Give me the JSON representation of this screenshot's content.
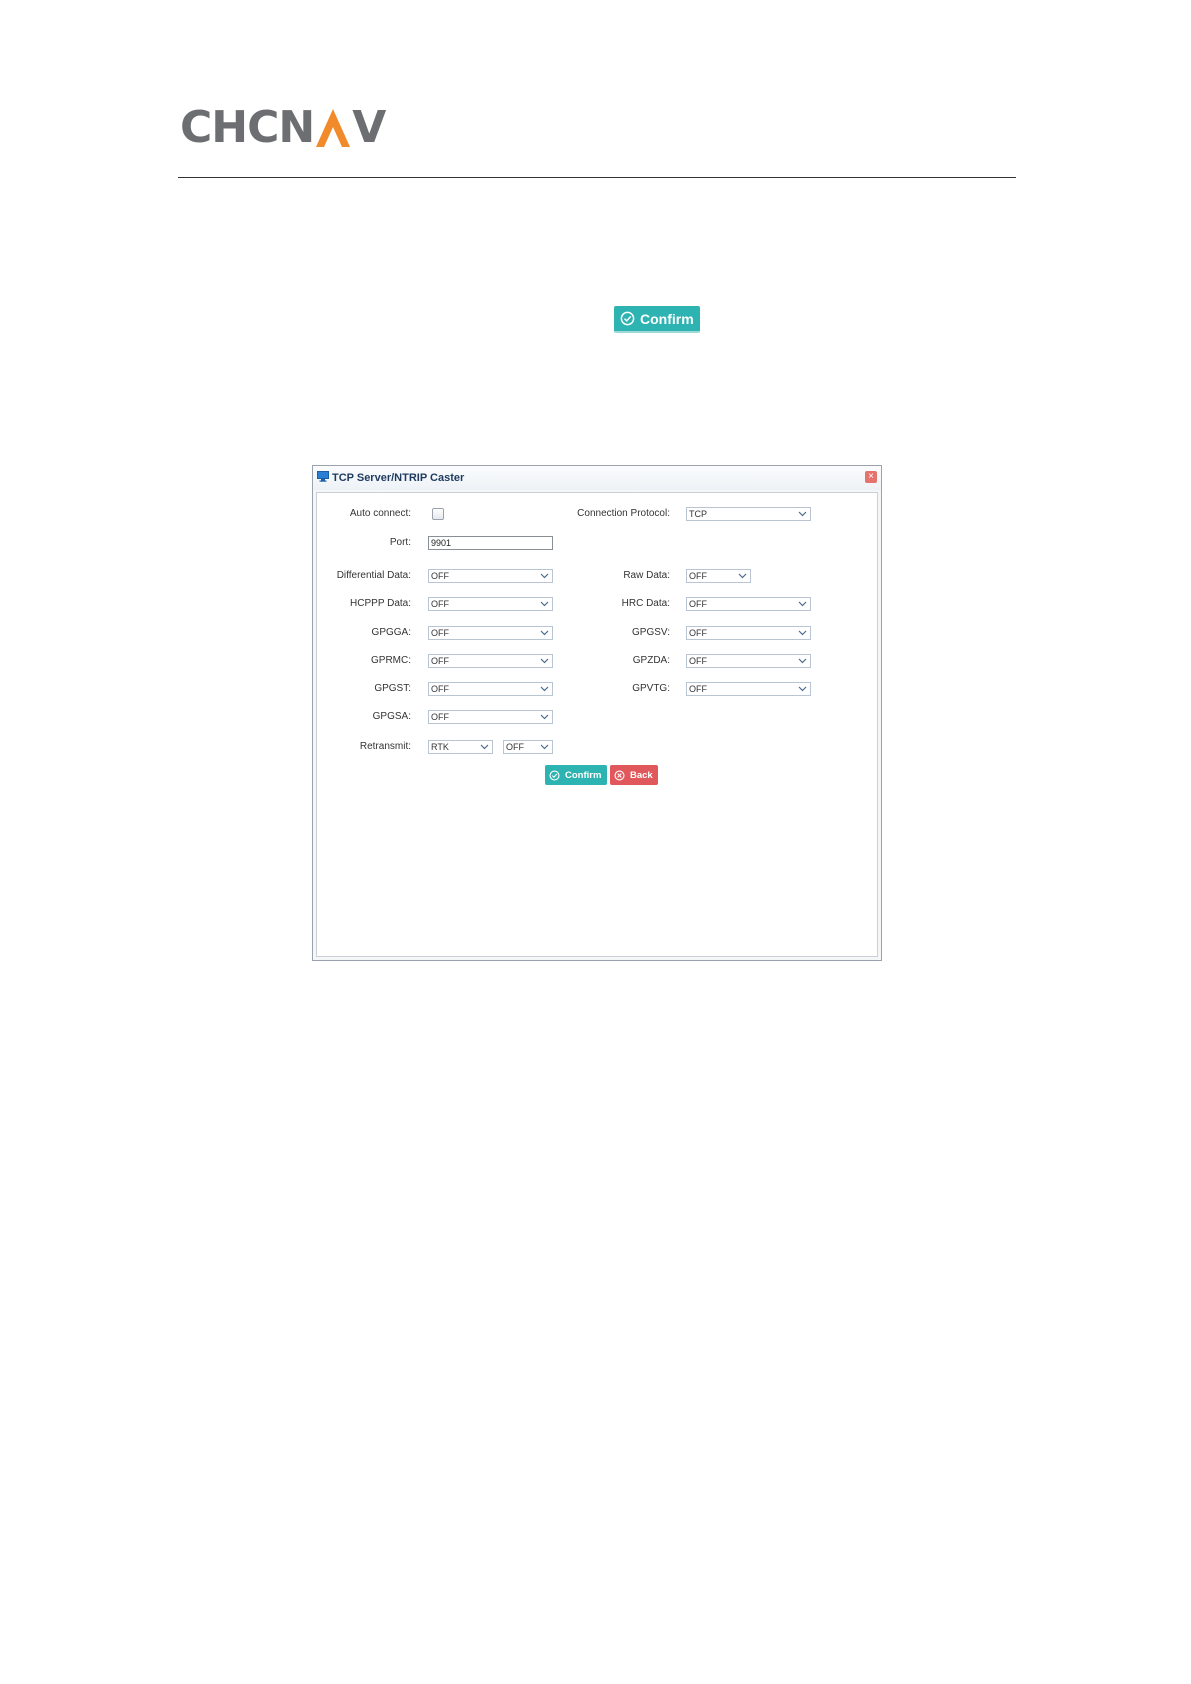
{
  "header": {
    "logo_left": "CHCN",
    "logo_right": "V"
  },
  "doc_button": {
    "label": "Confirm"
  },
  "dialog": {
    "title": "TCP Server/NTRIP Caster",
    "fields": {
      "auto_connect": {
        "label": "Auto connect:",
        "checked": false
      },
      "connection_protocol": {
        "label": "Connection Protocol:",
        "value": "TCP"
      },
      "port": {
        "label": "Port:",
        "value": "9901"
      },
      "differential_data": {
        "label": "Differential Data:",
        "value": "OFF"
      },
      "raw_data": {
        "label": "Raw Data:",
        "value": "OFF"
      },
      "hcppp_data": {
        "label": "HCPPP Data:",
        "value": "OFF"
      },
      "hrc_data": {
        "label": "HRC Data:",
        "value": "OFF"
      },
      "gpgga": {
        "label": "GPGGA:",
        "value": "OFF"
      },
      "gpgsv": {
        "label": "GPGSV:",
        "value": "OFF"
      },
      "gprmc": {
        "label": "GPRMC:",
        "value": "OFF"
      },
      "gpzda": {
        "label": "GPZDA:",
        "value": "OFF"
      },
      "gpgst": {
        "label": "GPGST:",
        "value": "OFF"
      },
      "gpvtg": {
        "label": "GPVTG:",
        "value": "OFF"
      },
      "gpgsa": {
        "label": "GPGSA:",
        "value": "OFF"
      },
      "retransmit": {
        "label": "Retransmit:",
        "source": "RTK",
        "value": "OFF"
      }
    },
    "confirm_label": "Confirm",
    "back_label": "Back"
  },
  "colors": {
    "teal_button": "#2db3b1",
    "red_button": "#e0585b",
    "logo_gray": "#6d6e71",
    "logo_orange": "#f18a2b"
  }
}
